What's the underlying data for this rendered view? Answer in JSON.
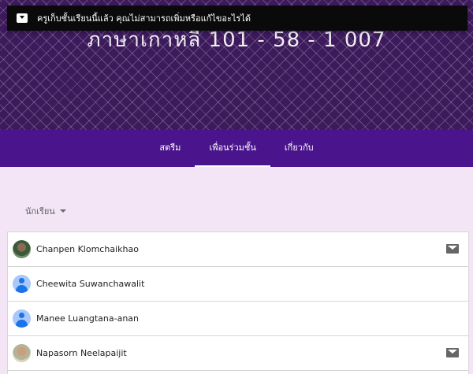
{
  "toast": {
    "icon": "archive-icon",
    "message": "ครูเก็บชั้นเรียนนี้แล้ว คุณไม่สามารถเพิ่มหรือแก้ไขอะไรได้"
  },
  "hero": {
    "title": "ภาษาเกาหลี 101 - 58 - 1 007"
  },
  "tabs": [
    {
      "label": "สตรีม"
    },
    {
      "label": "เพื่อนร่วมชั้น"
    },
    {
      "label": "เกี่ยวกับ"
    }
  ],
  "active_tab": "เพื่อนร่วมชั้น",
  "filter": {
    "label": "นักเรียน"
  },
  "students": [
    {
      "name": "Chanpen Klomchaikhao",
      "avatar": "photo",
      "email_icon": true
    },
    {
      "name": "Cheewita Suwanchawalit",
      "avatar": "default",
      "email_icon": false
    },
    {
      "name": "Manee Luangtana-anan",
      "avatar": "default",
      "email_icon": false
    },
    {
      "name": "Napasorn Neelapaijit",
      "avatar": "photo",
      "email_icon": true
    }
  ],
  "colors": {
    "hero": "#3c1a5b",
    "tabbar": "#4a148c",
    "background": "#f3e5f5",
    "toast": "#0a0a0a"
  }
}
